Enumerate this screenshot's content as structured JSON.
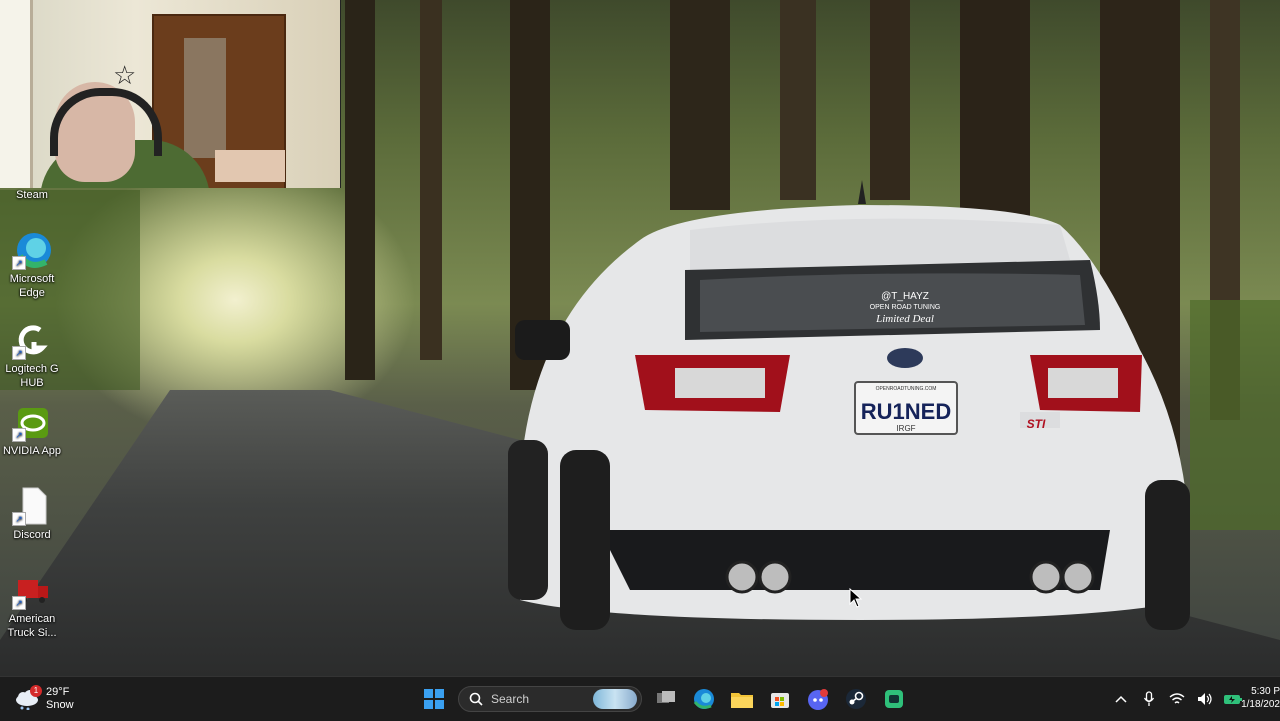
{
  "desktop": {
    "icons": [
      {
        "label": "Steam",
        "icon": "steam-icon"
      },
      {
        "label": "Microsoft Edge",
        "icon": "edge-icon"
      },
      {
        "label": "Logitech G HUB",
        "icon": "logitech-icon"
      },
      {
        "label": "NVIDIA App",
        "icon": "nvidia-icon"
      },
      {
        "label": "Discord",
        "icon": "file-icon"
      },
      {
        "label": "American Truck Si...",
        "icon": "truck-icon"
      }
    ],
    "wallpaper": {
      "plate": "RU1NED",
      "plate_small_top": "OPENROADTUNING.COM",
      "plate_small_bottom": "IRGF",
      "sticker_line1": "@T_HAYZ",
      "sticker_line2": "OPEN ROAD TUNING",
      "sticker_line3": "Limited Deal",
      "badge": "STI"
    }
  },
  "taskbar": {
    "weather": {
      "temp": "29°F",
      "condition": "Snow",
      "badge_count": "1"
    },
    "search_placeholder": "Search",
    "pinned": [
      "start-icon",
      "task-view-icon",
      "edge-icon",
      "file-explorer-icon",
      "microsoft-store-icon",
      "discord-icon",
      "steam-icon",
      "app-icon"
    ],
    "clock": {
      "time": "5:30 P",
      "date": "1/18/202"
    }
  },
  "colors": {
    "taskbar": "#1c1c1c",
    "accent": "#0078d4"
  }
}
